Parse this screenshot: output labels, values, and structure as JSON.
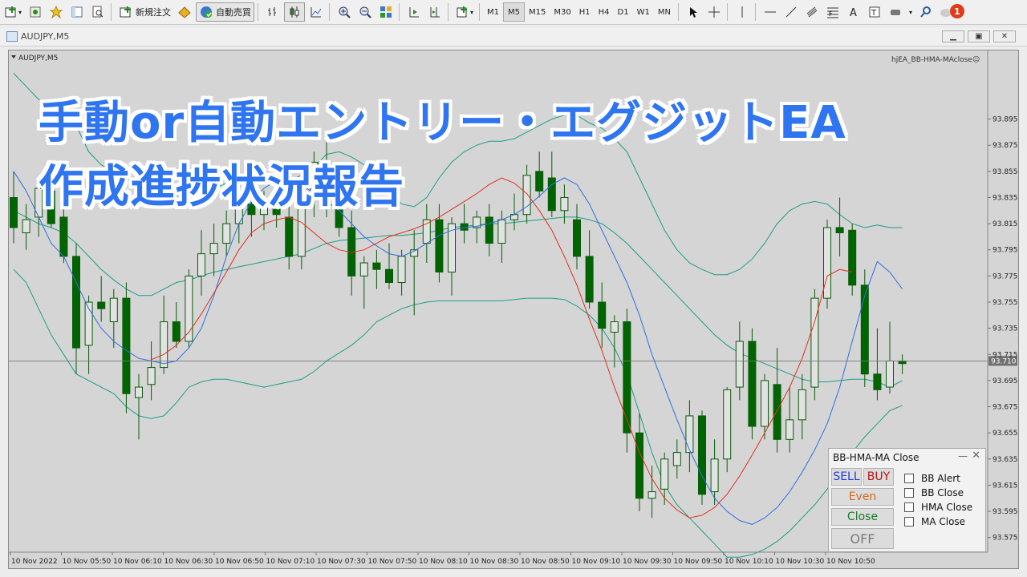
{
  "toolbar": {
    "new_order_label": "新規注文",
    "auto_trading_label": "自動売買",
    "timeframes": [
      "M1",
      "M5",
      "M15",
      "M30",
      "H1",
      "H4",
      "D1",
      "W1",
      "MN"
    ],
    "active_timeframe": "M5",
    "notification_count": "1"
  },
  "window": {
    "title": "AUDJPY,M5"
  },
  "chart": {
    "symbol_label": "AUDJPY,M5",
    "ea_label": "hjEA_BB-HMA-MAclose☺",
    "colors": {
      "bull": "#009000",
      "bear": "#006400",
      "bb": "#1b9e86",
      "hma": "#2f6fe0",
      "ma": "#e03020",
      "grid": "#a0a0a0"
    }
  },
  "chart_data": {
    "type": "candlestick",
    "ylim": [
      93.565,
      93.945
    ],
    "y_ticks": [
      "93.895",
      "93.875",
      "93.855",
      "93.835",
      "93.815",
      "93.795",
      "93.775",
      "93.755",
      "93.735",
      "93.715",
      "93.695",
      "93.675",
      "93.655",
      "93.635",
      "93.615",
      "93.595",
      "93.575"
    ],
    "current_price": "93.710",
    "current_price_value": 93.71,
    "x_labels": [
      "10 Nov 2022",
      "10 Nov 05:50",
      "10 Nov 06:10",
      "10 Nov 06:30",
      "10 Nov 06:50",
      "10 Nov 07:10",
      "10 Nov 07:30",
      "10 Nov 07:50",
      "10 Nov 08:10",
      "10 Nov 08:30",
      "10 Nov 08:50",
      "10 Nov 09:10",
      "10 Nov 09:30",
      "10 Nov 09:50",
      "10 Nov 10:10",
      "10 Nov 10:30",
      "10 Nov 10:50"
    ],
    "candles": [
      {
        "o": 93.835,
        "h": 93.855,
        "l": 93.8,
        "c": 93.812
      },
      {
        "o": 93.808,
        "h": 93.83,
        "l": 93.795,
        "c": 93.818
      },
      {
        "o": 93.82,
        "h": 93.85,
        "l": 93.805,
        "c": 93.842
      },
      {
        "o": 93.84,
        "h": 93.855,
        "l": 93.812,
        "c": 93.815
      },
      {
        "o": 93.82,
        "h": 93.835,
        "l": 93.785,
        "c": 93.79
      },
      {
        "o": 93.79,
        "h": 93.8,
        "l": 93.7,
        "c": 93.72
      },
      {
        "o": 93.722,
        "h": 93.76,
        "l": 93.7,
        "c": 93.755
      },
      {
        "o": 93.755,
        "h": 93.775,
        "l": 93.74,
        "c": 93.75
      },
      {
        "o": 93.74,
        "h": 93.765,
        "l": 93.72,
        "c": 93.758
      },
      {
        "o": 93.758,
        "h": 93.77,
        "l": 93.67,
        "c": 93.685
      },
      {
        "o": 93.682,
        "h": 93.7,
        "l": 93.65,
        "c": 93.69
      },
      {
        "o": 93.692,
        "h": 93.725,
        "l": 93.68,
        "c": 93.705
      },
      {
        "o": 93.705,
        "h": 93.76,
        "l": 93.7,
        "c": 93.74
      },
      {
        "o": 93.74,
        "h": 93.755,
        "l": 93.72,
        "c": 93.725
      },
      {
        "o": 93.725,
        "h": 93.78,
        "l": 93.72,
        "c": 93.775
      },
      {
        "o": 93.775,
        "h": 93.81,
        "l": 93.76,
        "c": 93.792
      },
      {
        "o": 93.792,
        "h": 93.815,
        "l": 93.775,
        "c": 93.8
      },
      {
        "o": 93.8,
        "h": 93.825,
        "l": 93.79,
        "c": 93.815
      },
      {
        "o": 93.815,
        "h": 93.85,
        "l": 93.8,
        "c": 93.84
      },
      {
        "o": 93.83,
        "h": 93.845,
        "l": 93.805,
        "c": 93.822
      },
      {
        "o": 93.822,
        "h": 93.84,
        "l": 93.81,
        "c": 93.83
      },
      {
        "o": 93.83,
        "h": 93.845,
        "l": 93.812,
        "c": 93.822
      },
      {
        "o": 93.82,
        "h": 93.835,
        "l": 93.78,
        "c": 93.79
      },
      {
        "o": 93.79,
        "h": 93.85,
        "l": 93.78,
        "c": 93.838
      },
      {
        "o": 93.838,
        "h": 93.87,
        "l": 93.82,
        "c": 93.862
      },
      {
        "o": 93.862,
        "h": 93.88,
        "l": 93.82,
        "c": 93.83
      },
      {
        "o": 93.83,
        "h": 93.845,
        "l": 93.805,
        "c": 93.812
      },
      {
        "o": 93.812,
        "h": 93.825,
        "l": 93.76,
        "c": 93.775
      },
      {
        "o": 93.775,
        "h": 93.79,
        "l": 93.75,
        "c": 93.785
      },
      {
        "o": 93.785,
        "h": 93.795,
        "l": 93.765,
        "c": 93.78
      },
      {
        "o": 93.78,
        "h": 93.8,
        "l": 93.765,
        "c": 93.77
      },
      {
        "o": 93.77,
        "h": 93.795,
        "l": 93.76,
        "c": 93.79
      },
      {
        "o": 93.79,
        "h": 93.81,
        "l": 93.745,
        "c": 93.795
      },
      {
        "o": 93.8,
        "h": 93.83,
        "l": 93.785,
        "c": 93.818
      },
      {
        "o": 93.818,
        "h": 93.83,
        "l": 93.77,
        "c": 93.778
      },
      {
        "o": 93.778,
        "h": 93.82,
        "l": 93.76,
        "c": 93.815
      },
      {
        "o": 93.815,
        "h": 93.83,
        "l": 93.8,
        "c": 93.81
      },
      {
        "o": 93.812,
        "h": 93.825,
        "l": 93.8,
        "c": 93.82
      },
      {
        "o": 93.82,
        "h": 93.83,
        "l": 93.79,
        "c": 93.8
      },
      {
        "o": 93.8,
        "h": 93.825,
        "l": 93.785,
        "c": 93.818
      },
      {
        "o": 93.818,
        "h": 93.838,
        "l": 93.81,
        "c": 93.822
      },
      {
        "o": 93.822,
        "h": 93.86,
        "l": 93.815,
        "c": 93.852
      },
      {
        "o": 93.855,
        "h": 93.87,
        "l": 93.835,
        "c": 93.84
      },
      {
        "o": 93.85,
        "h": 93.87,
        "l": 93.82,
        "c": 93.825
      },
      {
        "o": 93.825,
        "h": 93.845,
        "l": 93.815,
        "c": 93.835
      },
      {
        "o": 93.818,
        "h": 93.83,
        "l": 93.78,
        "c": 93.79
      },
      {
        "o": 93.79,
        "h": 93.81,
        "l": 93.75,
        "c": 93.755
      },
      {
        "o": 93.755,
        "h": 93.77,
        "l": 93.72,
        "c": 93.735
      },
      {
        "o": 93.732,
        "h": 93.745,
        "l": 93.705,
        "c": 93.74
      },
      {
        "o": 93.74,
        "h": 93.75,
        "l": 93.64,
        "c": 93.655
      },
      {
        "o": 93.655,
        "h": 93.67,
        "l": 93.595,
        "c": 93.605
      },
      {
        "o": 93.605,
        "h": 93.63,
        "l": 93.59,
        "c": 93.61
      },
      {
        "o": 93.612,
        "h": 93.64,
        "l": 93.6,
        "c": 93.635
      },
      {
        "o": 93.63,
        "h": 93.65,
        "l": 93.62,
        "c": 93.64
      },
      {
        "o": 93.64,
        "h": 93.68,
        "l": 93.625,
        "c": 93.668
      },
      {
        "o": 93.668,
        "h": 93.672,
        "l": 93.6,
        "c": 93.608
      },
      {
        "o": 93.61,
        "h": 93.65,
        "l": 93.6,
        "c": 93.635
      },
      {
        "o": 93.635,
        "h": 93.69,
        "l": 93.625,
        "c": 93.688
      },
      {
        "o": 93.69,
        "h": 93.74,
        "l": 93.68,
        "c": 93.725
      },
      {
        "o": 93.725,
        "h": 93.735,
        "l": 93.65,
        "c": 93.66
      },
      {
        "o": 93.66,
        "h": 93.7,
        "l": 93.65,
        "c": 93.695
      },
      {
        "o": 93.692,
        "h": 93.72,
        "l": 93.64,
        "c": 93.65
      },
      {
        "o": 93.65,
        "h": 93.69,
        "l": 93.64,
        "c": 93.665
      },
      {
        "o": 93.665,
        "h": 93.7,
        "l": 93.65,
        "c": 93.688
      },
      {
        "o": 93.69,
        "h": 93.765,
        "l": 93.68,
        "c": 93.758
      },
      {
        "o": 93.758,
        "h": 93.818,
        "l": 93.75,
        "c": 93.812
      },
      {
        "o": 93.812,
        "h": 93.835,
        "l": 93.79,
        "c": 93.808
      },
      {
        "o": 93.81,
        "h": 93.815,
        "l": 93.76,
        "c": 93.768
      },
      {
        "o": 93.768,
        "h": 93.78,
        "l": 93.69,
        "c": 93.7
      },
      {
        "o": 93.7,
        "h": 93.735,
        "l": 93.68,
        "c": 93.688
      },
      {
        "o": 93.69,
        "h": 93.74,
        "l": 93.685,
        "c": 93.71
      },
      {
        "o": 93.71,
        "h": 93.715,
        "l": 93.7,
        "c": 93.708
      }
    ],
    "bb_upper": [
      93.93,
      93.92,
      93.91,
      93.905,
      93.9,
      93.89,
      93.87,
      93.86,
      93.855,
      93.85,
      93.845,
      93.84,
      93.838,
      93.836,
      93.835,
      93.838,
      93.842,
      93.846,
      93.85,
      93.852,
      93.852,
      93.85,
      93.848,
      93.852,
      93.858,
      93.868,
      93.87,
      93.866,
      93.86,
      93.85,
      93.84,
      93.83,
      93.828,
      93.835,
      93.85,
      93.862,
      93.87,
      93.875,
      93.878,
      93.878,
      93.88,
      93.885,
      93.89,
      93.895,
      93.898,
      93.898,
      93.892,
      93.888,
      93.88,
      93.87,
      93.85,
      93.83,
      93.81,
      93.795,
      93.785,
      93.78,
      93.776,
      93.776,
      93.78,
      93.788,
      93.8,
      93.815,
      93.825,
      93.83,
      93.832,
      93.83,
      93.822,
      93.815,
      93.812,
      93.814,
      93.812,
      93.812
    ],
    "bb_mid": [
      93.825,
      93.82,
      93.815,
      93.812,
      93.808,
      93.8,
      93.79,
      93.78,
      93.772,
      93.765,
      93.76,
      93.76,
      93.765,
      93.77,
      93.772,
      93.775,
      93.778,
      93.78,
      93.782,
      93.784,
      93.786,
      93.788,
      93.79,
      93.792,
      93.796,
      93.8,
      93.802,
      93.803,
      93.804,
      93.805,
      93.806,
      93.806,
      93.807,
      93.808,
      93.81,
      93.812,
      93.813,
      93.814,
      93.815,
      93.815,
      93.816,
      93.817,
      93.818,
      93.819,
      93.82,
      93.82,
      93.818,
      93.815,
      93.808,
      93.8,
      93.79,
      93.78,
      93.77,
      93.76,
      93.75,
      93.74,
      93.73,
      93.722,
      93.716,
      93.712,
      93.708,
      93.704,
      93.7,
      93.696,
      93.694,
      93.694,
      93.695,
      93.696,
      93.696,
      93.694,
      93.69,
      93.695
    ],
    "bb_lower": [
      93.78,
      93.77,
      93.75,
      93.73,
      93.715,
      93.7,
      93.695,
      93.69,
      93.685,
      93.675,
      93.668,
      93.666,
      93.668,
      93.678,
      93.69,
      93.694,
      93.696,
      93.696,
      93.694,
      93.692,
      93.69,
      93.692,
      93.694,
      93.696,
      93.702,
      93.71,
      93.716,
      93.722,
      93.73,
      93.74,
      93.745,
      93.75,
      93.753,
      93.755,
      93.756,
      93.756,
      93.756,
      93.756,
      93.756,
      93.756,
      93.757,
      93.758,
      93.758,
      93.758,
      93.757,
      93.752,
      93.745,
      93.735,
      93.72,
      93.7,
      93.67,
      93.64,
      93.615,
      93.6,
      93.59,
      93.58,
      93.57,
      93.56,
      93.56,
      93.562,
      93.566,
      93.572,
      93.58,
      93.59,
      93.6,
      93.612,
      93.626,
      93.64,
      93.652,
      93.662,
      93.672,
      93.676
    ],
    "hma": [
      93.855,
      93.84,
      93.82,
      93.8,
      93.79,
      93.77,
      93.75,
      93.735,
      93.725,
      93.718,
      93.712,
      93.71,
      93.708,
      93.71,
      93.72,
      93.735,
      93.76,
      93.79,
      93.815,
      93.832,
      93.842,
      93.848,
      93.85,
      93.845,
      93.838,
      93.832,
      93.825,
      93.815,
      93.805,
      93.798,
      93.792,
      93.79,
      93.794,
      93.8,
      93.806,
      93.81,
      93.812,
      93.813,
      93.815,
      93.818,
      93.822,
      93.828,
      93.836,
      93.845,
      93.85,
      93.845,
      93.83,
      93.81,
      93.79,
      93.77,
      93.745,
      93.715,
      93.69,
      93.665,
      93.642,
      93.622,
      93.605,
      93.595,
      93.588,
      93.585,
      93.59,
      93.598,
      93.61,
      93.625,
      93.642,
      93.662,
      93.69,
      93.725,
      93.76,
      93.786,
      93.778,
      93.765
    ],
    "ma": [
      null,
      null,
      null,
      null,
      null,
      null,
      null,
      null,
      null,
      null,
      null,
      93.711,
      93.715,
      93.722,
      93.732,
      93.746,
      93.762,
      93.778,
      93.795,
      93.808,
      93.815,
      93.818,
      93.82,
      93.816,
      93.808,
      93.8,
      93.795,
      93.793,
      93.795,
      93.8,
      93.805,
      93.808,
      93.811,
      93.815,
      93.82,
      93.826,
      93.832,
      93.838,
      93.845,
      93.85,
      93.846,
      93.838,
      93.825,
      93.81,
      93.79,
      93.768,
      93.742,
      93.718,
      93.69,
      93.665,
      93.64,
      93.62,
      93.605,
      93.596,
      93.59,
      93.592,
      93.598,
      93.608,
      93.622,
      93.638,
      93.655,
      93.672,
      93.69,
      93.712,
      93.74,
      93.775,
      93.78,
      93.778,
      null,
      null,
      null,
      null
    ]
  },
  "overlay": {
    "line1": "手動or自動エントリー・エグジットEA",
    "line2": "作成進捗状況報告"
  },
  "panel": {
    "title": "BB-HMA-MA Close",
    "minimize": "—",
    "close": "✕",
    "sell_label": "SELL",
    "buy_label": "BUY",
    "even_label": "Even",
    "close_label": "Close",
    "off_label": "OFF",
    "checkboxes": [
      "BB Alert",
      "BB Close",
      "HMA Close",
      "MA Close"
    ],
    "colors": {
      "sell": "#1f3fd0",
      "buy": "#c01010",
      "even": "#d06a20",
      "close": "#1a7a2a",
      "off": "#7a7a7a"
    }
  }
}
